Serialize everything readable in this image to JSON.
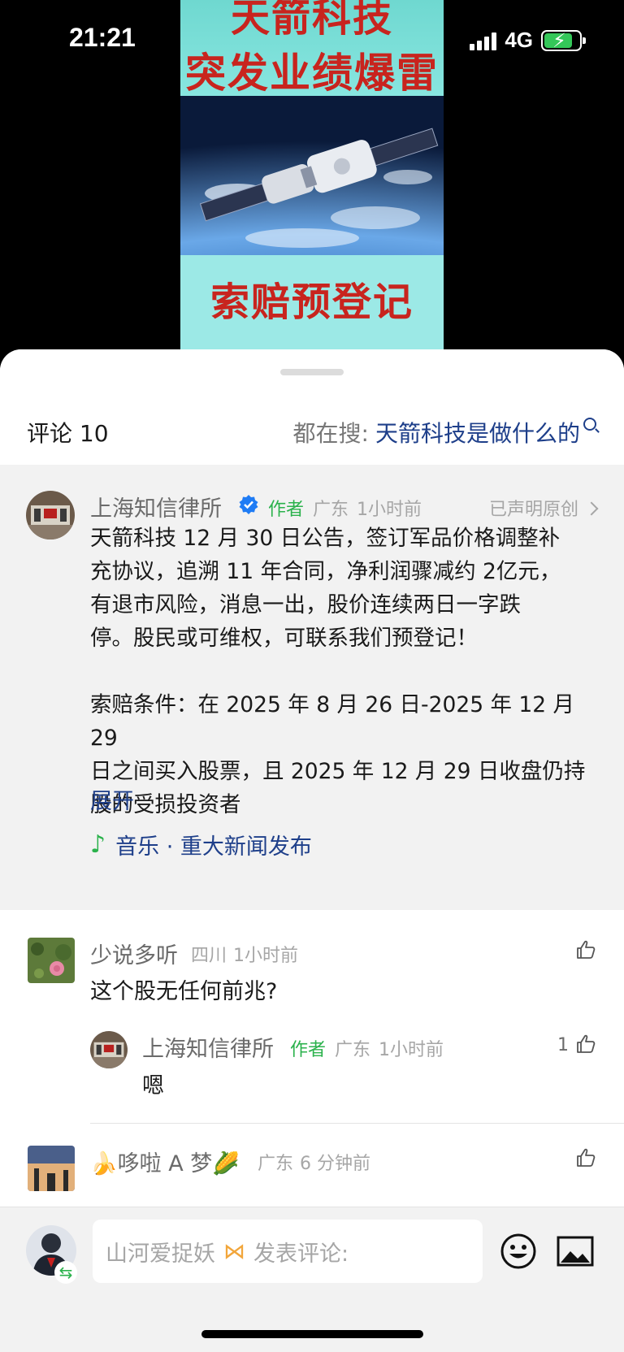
{
  "status": {
    "time": "21:21",
    "network": "4G"
  },
  "video": {
    "headline1": "天箭科技",
    "headline2": "突发业绩爆雷",
    "subline": "索赔预登记"
  },
  "header": {
    "comment_count_label": "评论 10",
    "search_prefix": "都在搜:",
    "search_term": "天箭科技是做什么的"
  },
  "pinned_post": {
    "author": "上海知信律所",
    "author_tag": "作者",
    "location": "广东",
    "time": "1小时前",
    "original_label": "已声明原创",
    "text": "天箭科技 12 月 30 日公告，签订军品价格调整补\n充协议，追溯 11 年合同，净利润骤减约 2亿元，\n有退市风险，消息一出，股价连续两日一字跌\n停。股民或可维权，可联系我们预登记！\n\n索赔条件：在 2025 年 8 月 26 日-2025 年 12 月 29\n日之间买入股票，且 2025 年 12 月 29 日收盘仍持\n股的受损投资者",
    "expand_label": "展开",
    "music_label": "音乐 · 重大新闻发布"
  },
  "comments": [
    {
      "author": "少说多听",
      "location": "四川",
      "time": "1小时前",
      "text": "这个股无任何前兆?",
      "reply": {
        "author": "上海知信律所",
        "author_tag": "作者",
        "location": "广东",
        "time": "1小时前",
        "text": "嗯",
        "likes": "1"
      }
    },
    {
      "author": "🍌哆啦 A 梦🌽",
      "location": "广东",
      "time": "6 分钟前"
    }
  ],
  "composer": {
    "username": "山河爱捉妖",
    "placeholder": "发表评论:"
  },
  "icons": {
    "verified": "verified-badge-icon",
    "like": "thumbs-up-icon",
    "emoji": "emoji-icon",
    "image": "image-icon",
    "music": "music-note-icon"
  },
  "colors": {
    "link_blue": "#1e3f8a",
    "author_green": "#2bb24c",
    "verified_blue": "#1f7cf5",
    "headline_red": "#c8241e"
  }
}
